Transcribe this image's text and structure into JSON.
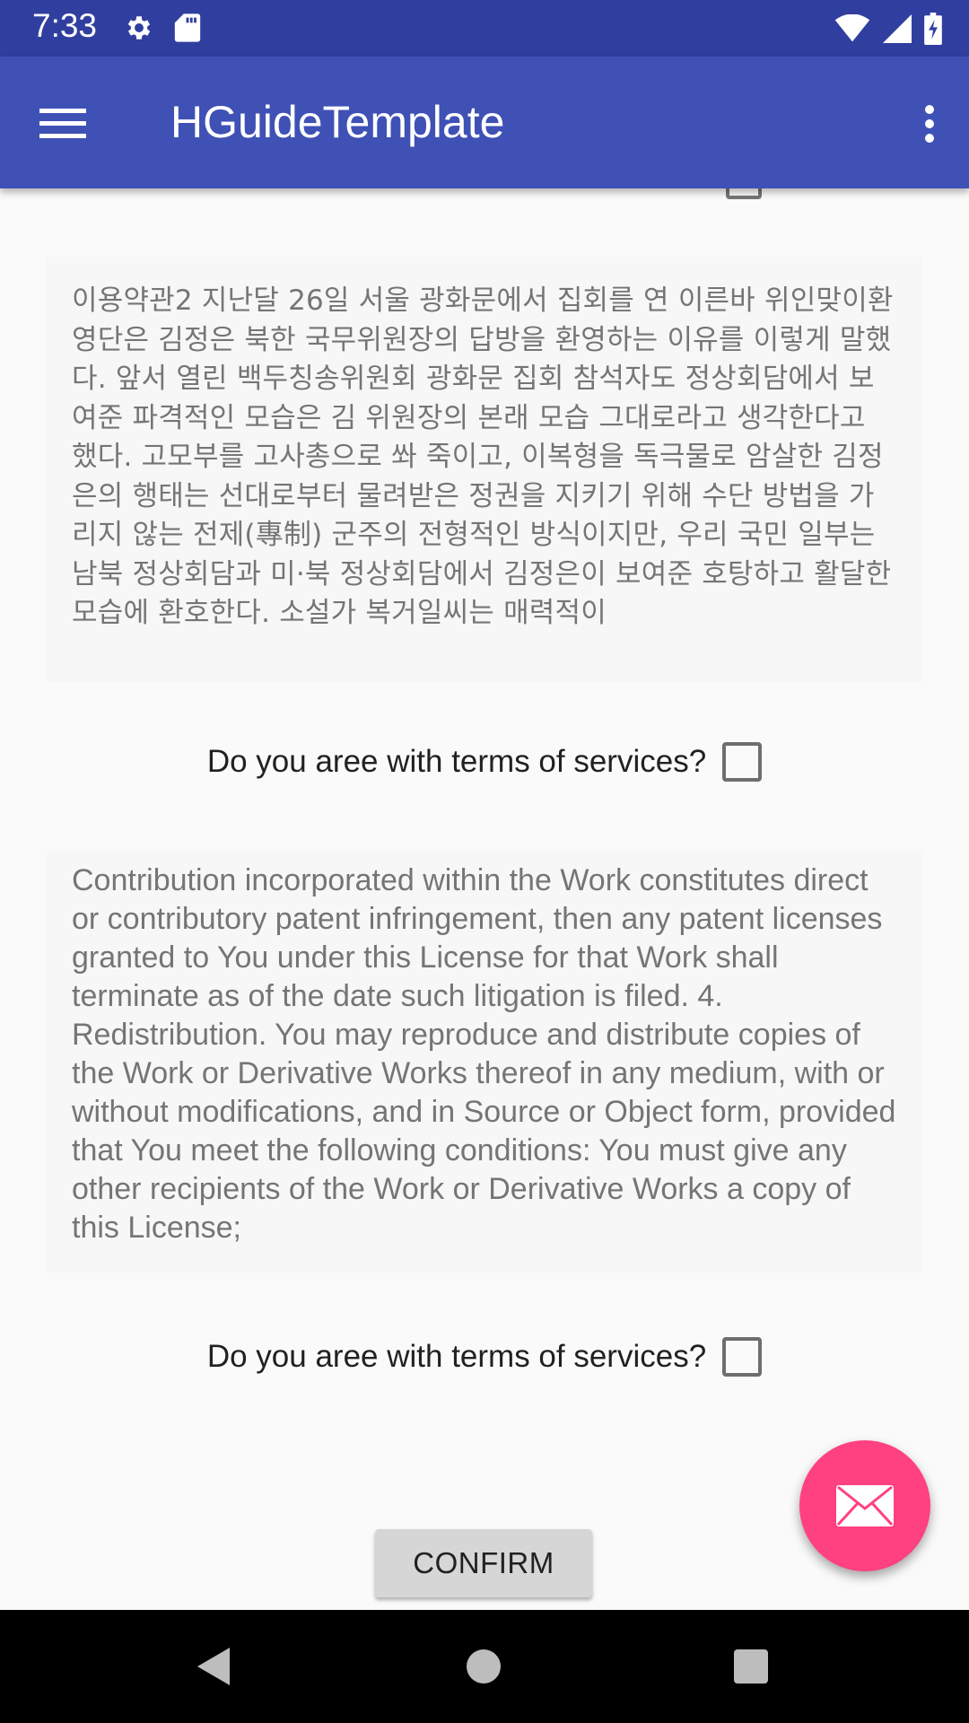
{
  "status_bar": {
    "time": "7:33",
    "icons": [
      "gear-icon",
      "sd-card-icon",
      "wifi-icon",
      "signal-icon",
      "battery-charging-icon"
    ],
    "background": "#303f9f"
  },
  "app_bar": {
    "title": "HGuideTemplate",
    "background": "#3f51b5",
    "icons": [
      "hamburger-menu-icon",
      "more-vertical-icon"
    ]
  },
  "terms": [
    {
      "text": "이용약관2 지난달 26일 서울 광화문에서 집회를 연 이른바 위인맞이환영단은 김정은 북한 국무위원장의 답방을 환영하는 이유를 이렇게 말했다. 앞서 열린 백두칭송위원회 광화문 집회 참석자도 정상회담에서 보여준 파격적인 모습은 김 위원장의 본래 모습 그대로라고 생각한다고 했다. 고모부를 고사총으로 쏴 죽이고, 이복형을 독극물로 암살한 김정은의 행태는 선대로부터 물려받은 정권을 지키기 위해 수단 방법을 가리지 않는 전제(專制) 군주의 전형적인 방식이지만, 우리 국민 일부는 남북 정상회담과 미·북 정상회담에서 김정은이 보여준 호탕하고 활달한 모습에 환호한다. 소설가 복거일씨는 매력적이",
      "agree_label": "Do you aree with terms of services?"
    },
    {
      "text": "Contribution incorporated within the Work constitutes direct or contributory patent infringement, then any patent licenses granted to You under this License for that Work shall terminate as of the date such litigation is filed. 4. Redistribution. You may reproduce and distribute copies of the Work or Derivative Works thereof in any medium, with or without modifications, and in Source or Object form, provided that You meet the following conditions: You must give any other recipients of the Work or Derivative Works a copy of this License;",
      "agree_label": "Do you aree with terms of services?"
    }
  ],
  "confirm_button": {
    "label": "CONFIRM"
  },
  "fab": {
    "icon": "email-icon",
    "color": "#ff4081"
  },
  "nav_bar": {
    "icons": [
      "back-icon",
      "home-icon",
      "recents-icon"
    ]
  }
}
